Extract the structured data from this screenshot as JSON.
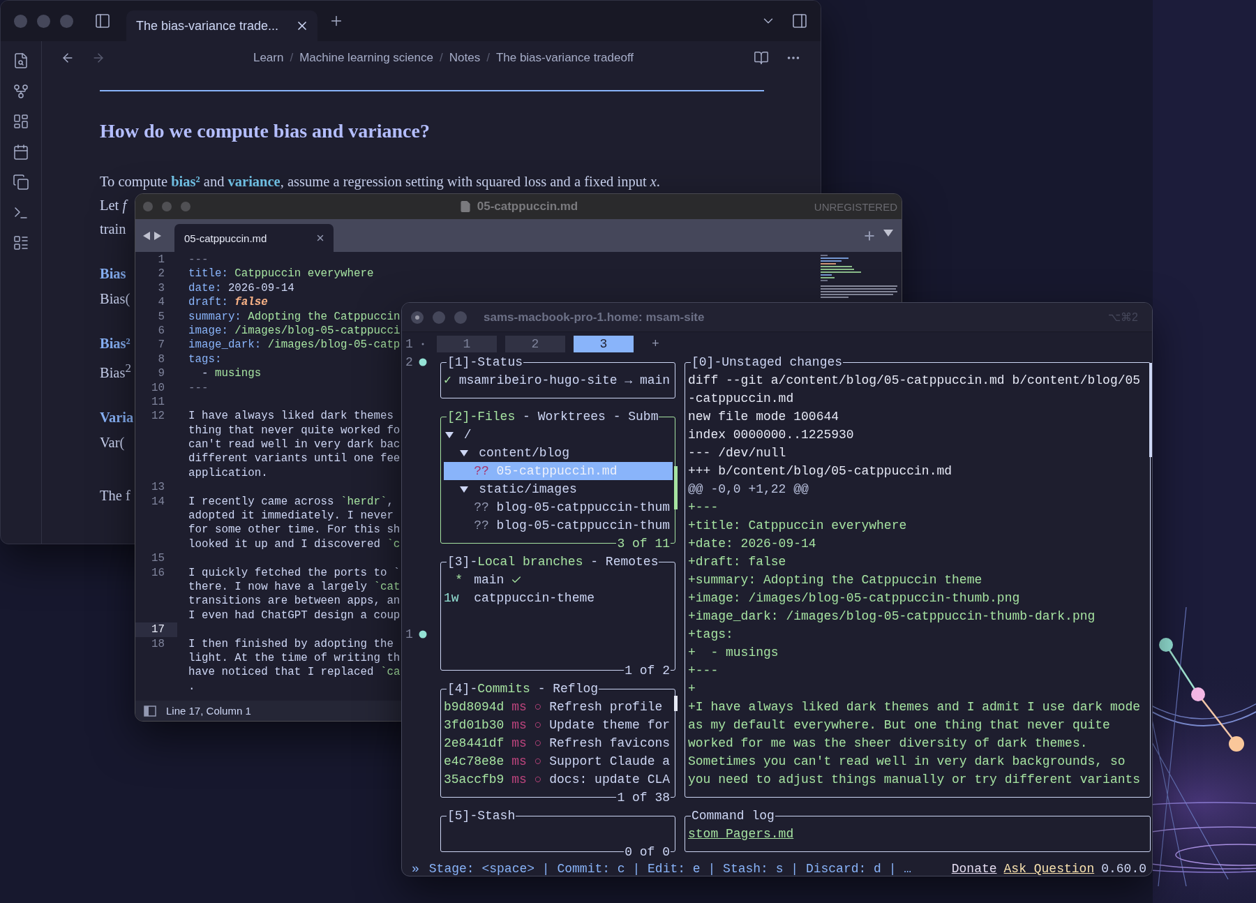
{
  "notes": {
    "tab": {
      "title": "The bias-variance trade...",
      "selected": true
    },
    "breadcrumb": {
      "separator": "/",
      "items": [
        "Learn",
        "Machine learning science",
        "Notes",
        "The bias-variance tradeoff"
      ]
    },
    "heading": "How do we compute bias and variance?",
    "intro": [
      {
        "text": "To compute ",
        "link": false
      },
      {
        "text": "bias²",
        "link": true
      },
      {
        "text": " and ",
        "link": false
      },
      {
        "text": "variance",
        "link": true
      },
      {
        "text": ", assume a regression setting with squared loss and a fixed input *x*.",
        "link": false
      }
    ],
    "blocks": [
      {
        "kind": "text",
        "text": "Let *f*"
      },
      {
        "kind": "text",
        "text": "train"
      },
      {
        "kind": "heading",
        "text": "Bias"
      },
      {
        "kind": "math",
        "text": "Bias("
      },
      {
        "kind": "heading",
        "text": "Bias²"
      },
      {
        "kind": "math",
        "text": "Bias$^{2}$"
      },
      {
        "kind": "heading",
        "text": "Varia"
      },
      {
        "kind": "math",
        "text": "Var("
      },
      {
        "kind": "text",
        "text": "The f"
      }
    ]
  },
  "editor": {
    "title": "05-catppuccin.md",
    "license": "UNREGISTERED",
    "tab": {
      "label": "05-catppuccin.md",
      "selected": true
    },
    "lines": [
      {
        "number": "1",
        "current": false,
        "rows": [
          {
            "spans": [
              {
                "kind": "dash",
                "text": "---"
              }
            ]
          }
        ]
      },
      {
        "number": "2",
        "current": false,
        "rows": [
          {
            "spans": [
              {
                "kind": "key",
                "text": "title:"
              },
              {
                "kind": "string",
                "text": " Catppuccin everywhere"
              }
            ]
          }
        ]
      },
      {
        "number": "3",
        "current": false,
        "rows": [
          {
            "spans": [
              {
                "kind": "key",
                "text": "date:"
              },
              {
                "kind": "plain",
                "text": " 2026-09-14"
              }
            ]
          }
        ]
      },
      {
        "number": "4",
        "current": false,
        "rows": [
          {
            "spans": [
              {
                "kind": "key",
                "text": "draft:"
              },
              {
                "kind": "bool",
                "text": " false"
              }
            ]
          }
        ]
      },
      {
        "number": "5",
        "current": false,
        "rows": [
          {
            "spans": [
              {
                "kind": "key",
                "text": "summary:"
              },
              {
                "kind": "string",
                "text": " Adopting the Catppuccin"
              }
            ]
          }
        ]
      },
      {
        "number": "6",
        "current": false,
        "rows": [
          {
            "spans": [
              {
                "kind": "key",
                "text": "image:"
              },
              {
                "kind": "string",
                "text": " /images/blog-05-catppucci"
              }
            ]
          }
        ]
      },
      {
        "number": "7",
        "current": false,
        "rows": [
          {
            "spans": [
              {
                "kind": "key",
                "text": "image_dark:"
              },
              {
                "kind": "string",
                "text": " /images/blog-05-catp"
              }
            ]
          }
        ]
      },
      {
        "number": "8",
        "current": false,
        "rows": [
          {
            "spans": [
              {
                "kind": "key",
                "text": "tags:"
              }
            ]
          }
        ]
      },
      {
        "number": "9",
        "current": false,
        "rows": [
          {
            "spans": [
              {
                "kind": "plain",
                "text": "  -"
              },
              {
                "kind": "string",
                "text": " musings"
              }
            ]
          }
        ]
      },
      {
        "number": "10",
        "current": false,
        "rows": [
          {
            "spans": [
              {
                "kind": "dash",
                "text": "---"
              }
            ]
          }
        ]
      },
      {
        "number": "11",
        "current": false
      },
      {
        "number": "12",
        "current": false,
        "rows": [
          {
            "spans": [
              {
                "kind": "plain",
                "text": "I have always liked dark themes"
              }
            ]
          },
          {
            "spans": [
              {
                "kind": "plain",
                "text": "thing that never quite worked fo"
              }
            ]
          },
          {
            "spans": [
              {
                "kind": "plain",
                "text": "can't read well in very dark bac"
              }
            ]
          },
          {
            "spans": [
              {
                "kind": "plain",
                "text": "different variants until one fee"
              }
            ]
          },
          {
            "spans": [
              {
                "kind": "plain",
                "text": "application."
              }
            ]
          }
        ]
      },
      {
        "number": "13",
        "current": false
      },
      {
        "number": "14",
        "current": false,
        "rows": [
          {
            "spans": [
              {
                "kind": "plain",
                "text": "I recently came across "
              },
              {
                "kind": "code",
                "text": "`herdr`"
              },
              {
                "kind": "plain",
                "text": ","
              }
            ]
          },
          {
            "spans": [
              {
                "kind": "plain",
                "text": "adopted it immediately. I never"
              }
            ]
          },
          {
            "spans": [
              {
                "kind": "plain",
                "text": "for some other time. For this sh"
              }
            ]
          },
          {
            "spans": [
              {
                "kind": "plain",
                "text": "looked it up and I discovered "
              },
              {
                "kind": "code",
                "text": "`c"
              }
            ]
          }
        ]
      },
      {
        "number": "15",
        "current": false
      },
      {
        "number": "16",
        "current": false,
        "rows": [
          {
            "spans": [
              {
                "kind": "plain",
                "text": "I quickly fetched the ports to `"
              }
            ]
          },
          {
            "spans": [
              {
                "kind": "plain",
                "text": "there. I now have a largely "
              },
              {
                "kind": "code",
                "text": "`cat"
              }
            ]
          },
          {
            "spans": [
              {
                "kind": "plain",
                "text": "transitions are between apps, an"
              }
            ]
          },
          {
            "spans": [
              {
                "kind": "plain",
                "text": "I even had ChatGPT design a coup"
              }
            ]
          }
        ]
      },
      {
        "number": "17",
        "current": true
      },
      {
        "number": "18",
        "current": false,
        "rows": [
          {
            "spans": [
              {
                "kind": "plain",
                "text": "I then finished by adopting the"
              }
            ]
          },
          {
            "spans": [
              {
                "kind": "plain",
                "text": "light. At the time of writing th"
              }
            ]
          },
          {
            "spans": [
              {
                "kind": "plain",
                "text": "have noticed that I replaced "
              },
              {
                "kind": "code",
                "text": "`ca"
              }
            ]
          },
          {
            "spans": [
              {
                "kind": "plain",
                "text": "."
              }
            ]
          }
        ]
      }
    ],
    "status": "Line 17, Column 1"
  },
  "terminal": {
    "title": "sams-macbook-pro-1.home: msam-site",
    "shortcut": "⌥⌘2",
    "gutter": [
      {
        "number": "1",
        "active": false
      },
      {
        "number": "2",
        "active": true
      },
      {
        "number": "1",
        "active": true
      }
    ],
    "tabs": [
      {
        "label": "1",
        "selected": false
      },
      {
        "label": "2",
        "selected": false
      },
      {
        "label": "3",
        "selected": true
      }
    ],
    "new_tab": "+",
    "left_panels": [
      {
        "kind": "status",
        "prefix": "[1]-",
        "focused": false,
        "tabs": [
          {
            "label": "Status",
            "selected": false
          }
        ],
        "rows": [
          [
            {
              "kind": "ok",
              "text": "✓"
            },
            {
              "kind": "plain",
              "text": " msamribeiro-hugo-site → main"
            }
          ]
        ]
      },
      {
        "kind": "files",
        "prefix": "[2]-",
        "focused": true,
        "separator": " - ",
        "tabs": [
          {
            "label": "Files",
            "selected": true
          },
          {
            "label": "Worktrees",
            "selected": false
          },
          {
            "label": "Subm",
            "selected": false
          }
        ],
        "footer": "3 of 11",
        "tree": [
          {
            "label": "/",
            "expanded": true,
            "children": [
              {
                "label": "content/blog",
                "expanded": true,
                "children": [
                  {
                    "status": "??",
                    "label": "05-catppuccin.md",
                    "selected": true
                  }
                ]
              },
              {
                "label": "static/images",
                "expanded": true,
                "children": [
                  {
                    "status": "??",
                    "label": "blog-05-catppuccin-thum",
                    "selected": false
                  },
                  {
                    "status": "??",
                    "label": "blog-05-catppuccin-thum",
                    "selected": false
                  }
                ]
              }
            ]
          }
        ]
      },
      {
        "kind": "branches",
        "prefix": "[3]-",
        "focused": false,
        "separator": " - ",
        "tabs": [
          {
            "label": "Local branches",
            "selected": true
          },
          {
            "label": "Remotes",
            "selected": false
          }
        ],
        "footer": "1 of 2",
        "branches": [
          {
            "age": "*",
            "name": "main",
            "current": true
          },
          {
            "age": "1w",
            "name": "catppuccin-theme",
            "current": false
          }
        ]
      },
      {
        "kind": "commits",
        "prefix": "[4]-",
        "focused": false,
        "separator": " - ",
        "tabs": [
          {
            "label": "Commits",
            "selected": true
          },
          {
            "label": "Reflog",
            "selected": false
          }
        ],
        "footer": "1 of 38",
        "commits": [
          {
            "hash": "b9d8094d",
            "author": "ms",
            "graph": "○",
            "message": "Refresh profile"
          },
          {
            "hash": "3fd01b30",
            "author": "ms",
            "graph": "○",
            "message": "Update theme for"
          },
          {
            "hash": "2e8441df",
            "author": "ms",
            "graph": "○",
            "message": "Refresh favicons"
          },
          {
            "hash": "e4c78e8e",
            "author": "ms",
            "graph": "○",
            "message": "Support Claude a"
          },
          {
            "hash": "35accfb9",
            "author": "ms",
            "graph": "○",
            "message": "docs: update CLA"
          }
        ]
      },
      {
        "kind": "stash",
        "prefix": "[5]-",
        "focused": false,
        "tabs": [
          {
            "label": "Stash",
            "selected": false
          }
        ],
        "footer": "0 of 0"
      }
    ],
    "right_panels": [
      {
        "kind": "diff",
        "prefix": "[0]-",
        "focused": false,
        "tabs": [
          {
            "label": "Unstaged changes",
            "selected": false
          }
        ],
        "rows": [
          {
            "kind": "meta",
            "text": "diff --git a/content/blog/05-catppuccin.md b/content/blog/05"
          },
          {
            "kind": "meta",
            "text": "-catppuccin.md"
          },
          {
            "kind": "meta",
            "text": "new file mode 100644"
          },
          {
            "kind": "meta",
            "text": "index 0000000..1225930"
          },
          {
            "kind": "meta",
            "text": "--- /dev/null"
          },
          {
            "kind": "meta",
            "text": "+++ b/content/blog/05-catppuccin.md"
          },
          {
            "kind": "hunk",
            "text": "@@ -0,0 +1,22 @@"
          },
          {
            "kind": "added",
            "text": "+---"
          },
          {
            "kind": "added",
            "text": "+title: Catppuccin everywhere"
          },
          {
            "kind": "added",
            "text": "+date: 2026-09-14"
          },
          {
            "kind": "added",
            "text": "+draft: false"
          },
          {
            "kind": "added",
            "text": "+summary: Adopting the Catppuccin theme"
          },
          {
            "kind": "added",
            "text": "+image: /images/blog-05-catppuccin-thumb.png"
          },
          {
            "kind": "added",
            "text": "+image_dark: /images/blog-05-catppuccin-thumb-dark.png"
          },
          {
            "kind": "added",
            "text": "+tags:"
          },
          {
            "kind": "added",
            "text": "+  - musings"
          },
          {
            "kind": "added",
            "text": "+---"
          },
          {
            "kind": "added",
            "text": "+"
          },
          {
            "kind": "added",
            "text": "+I have always liked dark themes and I admit I use dark mode"
          },
          {
            "kind": "added",
            "text": "as my default everywhere. But one thing that never quite"
          },
          {
            "kind": "added",
            "text": "worked for me was the sheer diversity of dark themes."
          },
          {
            "kind": "added",
            "text": "Sometimes you can't read well in very dark backgrounds, so"
          },
          {
            "kind": "added",
            "text": "you need to adjust things manually or try different variants"
          }
        ]
      },
      {
        "kind": "log",
        "focused": false,
        "tabs": [
          {
            "label": "Command log",
            "selected": false
          }
        ],
        "rows": [
          {
            "kind": "link",
            "text": "stom_Pagers.md"
          }
        ]
      }
    ],
    "status_line": {
      "prompt": "»",
      "hints": "Stage: <space> | Commit: c | Edit: e | Stash: s | Discard: d | …",
      "links": [
        {
          "text": "Donate",
          "color": "#e4dcf0"
        },
        {
          "text": "Ask Question",
          "color": "#f9e2af"
        }
      ],
      "version": "0.60.0"
    }
  }
}
